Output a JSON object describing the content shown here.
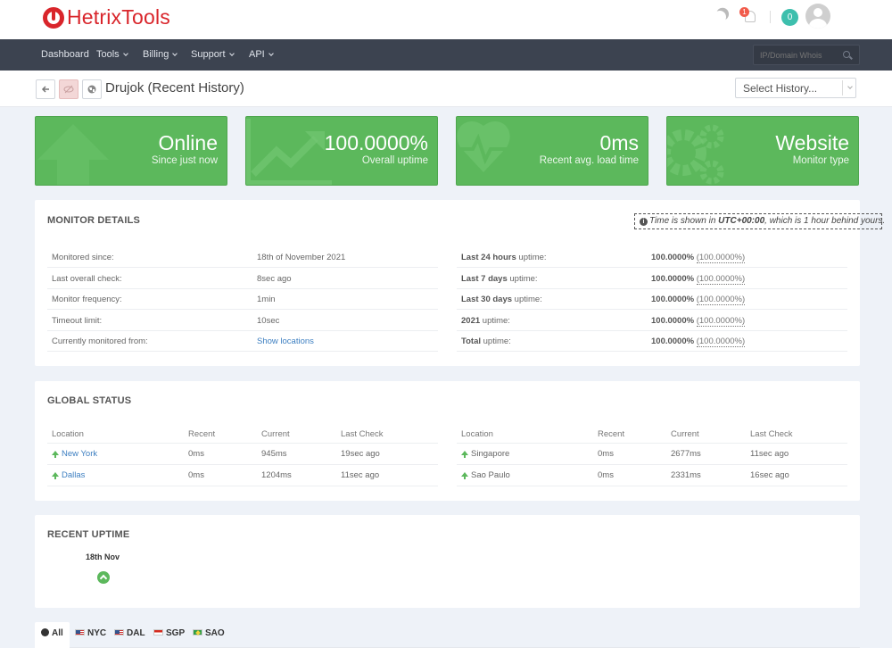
{
  "brand": {
    "name": "HetrixTools"
  },
  "header": {
    "notification_count": "1",
    "credits_count": "0"
  },
  "nav": {
    "items": [
      {
        "label": "Dashboard",
        "dropdown": false
      },
      {
        "label": "Tools",
        "dropdown": true
      },
      {
        "label": "Billing",
        "dropdown": true
      },
      {
        "label": "Support",
        "dropdown": true
      },
      {
        "label": "API",
        "dropdown": true
      }
    ],
    "search_placeholder": "IP/Domain Whois"
  },
  "subheader": {
    "title": "Drujok (Recent History)",
    "history_select": "Select History..."
  },
  "stats": [
    {
      "value": "Online",
      "label": "Since just now",
      "icon": "up-arrow-icon"
    },
    {
      "value": "100.0000%",
      "label": "Overall uptime",
      "icon": "trend-chart-icon"
    },
    {
      "value": "0ms",
      "label": "Recent avg. load time",
      "icon": "heartbeat-icon"
    },
    {
      "value": "Website",
      "label": "Monitor type",
      "icon": "gears-icon"
    }
  ],
  "monitor_details": {
    "title": "MONITOR DETAILS",
    "tz_prefix": "Time is shown in ",
    "tz_zone": "UTC+00:00",
    "tz_suffix": ", which is 1 hour behind yours.",
    "left": [
      {
        "label": "Monitored since:",
        "value": "18th of November 2021"
      },
      {
        "label": "Last overall check:",
        "value": "8sec ago"
      },
      {
        "label": "Monitor frequency:",
        "value": "1min"
      },
      {
        "label": "Timeout limit:",
        "value": "10sec"
      },
      {
        "label": "Currently monitored from:",
        "value": "Show locations"
      }
    ],
    "right": [
      {
        "label_bold": "Last 24 hours",
        "label_rest": " uptime:",
        "value": "100.0000%",
        "alt": "(100.0000%)"
      },
      {
        "label_bold": "Last 7 days",
        "label_rest": " uptime:",
        "value": "100.0000%",
        "alt": "(100.0000%)"
      },
      {
        "label_bold": "Last 30 days",
        "label_rest": " uptime:",
        "value": "100.0000%",
        "alt": "(100.0000%)"
      },
      {
        "label_bold": "2021",
        "label_rest": " uptime:",
        "value": "100.0000%",
        "alt": "(100.0000%)"
      },
      {
        "label_bold": "Total",
        "label_rest": " uptime:",
        "value": "100.0000%",
        "alt": "(100.0000%)"
      }
    ]
  },
  "global_status": {
    "title": "GLOBAL STATUS",
    "columns": [
      "Location",
      "Recent",
      "Current",
      "Last Check"
    ],
    "left": [
      {
        "location": "New York",
        "recent": "0ms",
        "current": "945ms",
        "last_check": "19sec ago"
      },
      {
        "location": "Dallas",
        "recent": "0ms",
        "current": "1204ms",
        "last_check": "11sec ago"
      }
    ],
    "right": [
      {
        "location": "Singapore",
        "recent": "0ms",
        "current": "2677ms",
        "last_check": "11sec ago"
      },
      {
        "location": "Sao Paulo",
        "recent": "0ms",
        "current": "2331ms",
        "last_check": "16sec ago"
      }
    ]
  },
  "recent_uptime": {
    "title": "RECENT UPTIME",
    "date": "18th Nov"
  },
  "tabs": [
    {
      "label": "All",
      "icon": "globe-icon",
      "active": true
    },
    {
      "label": "NYC",
      "icon": "us-flag-icon"
    },
    {
      "label": "DAL",
      "icon": "us-flag-icon"
    },
    {
      "label": "SGP",
      "icon": "sg-flag-icon"
    },
    {
      "label": "SAO",
      "icon": "br-flag-icon"
    }
  ]
}
